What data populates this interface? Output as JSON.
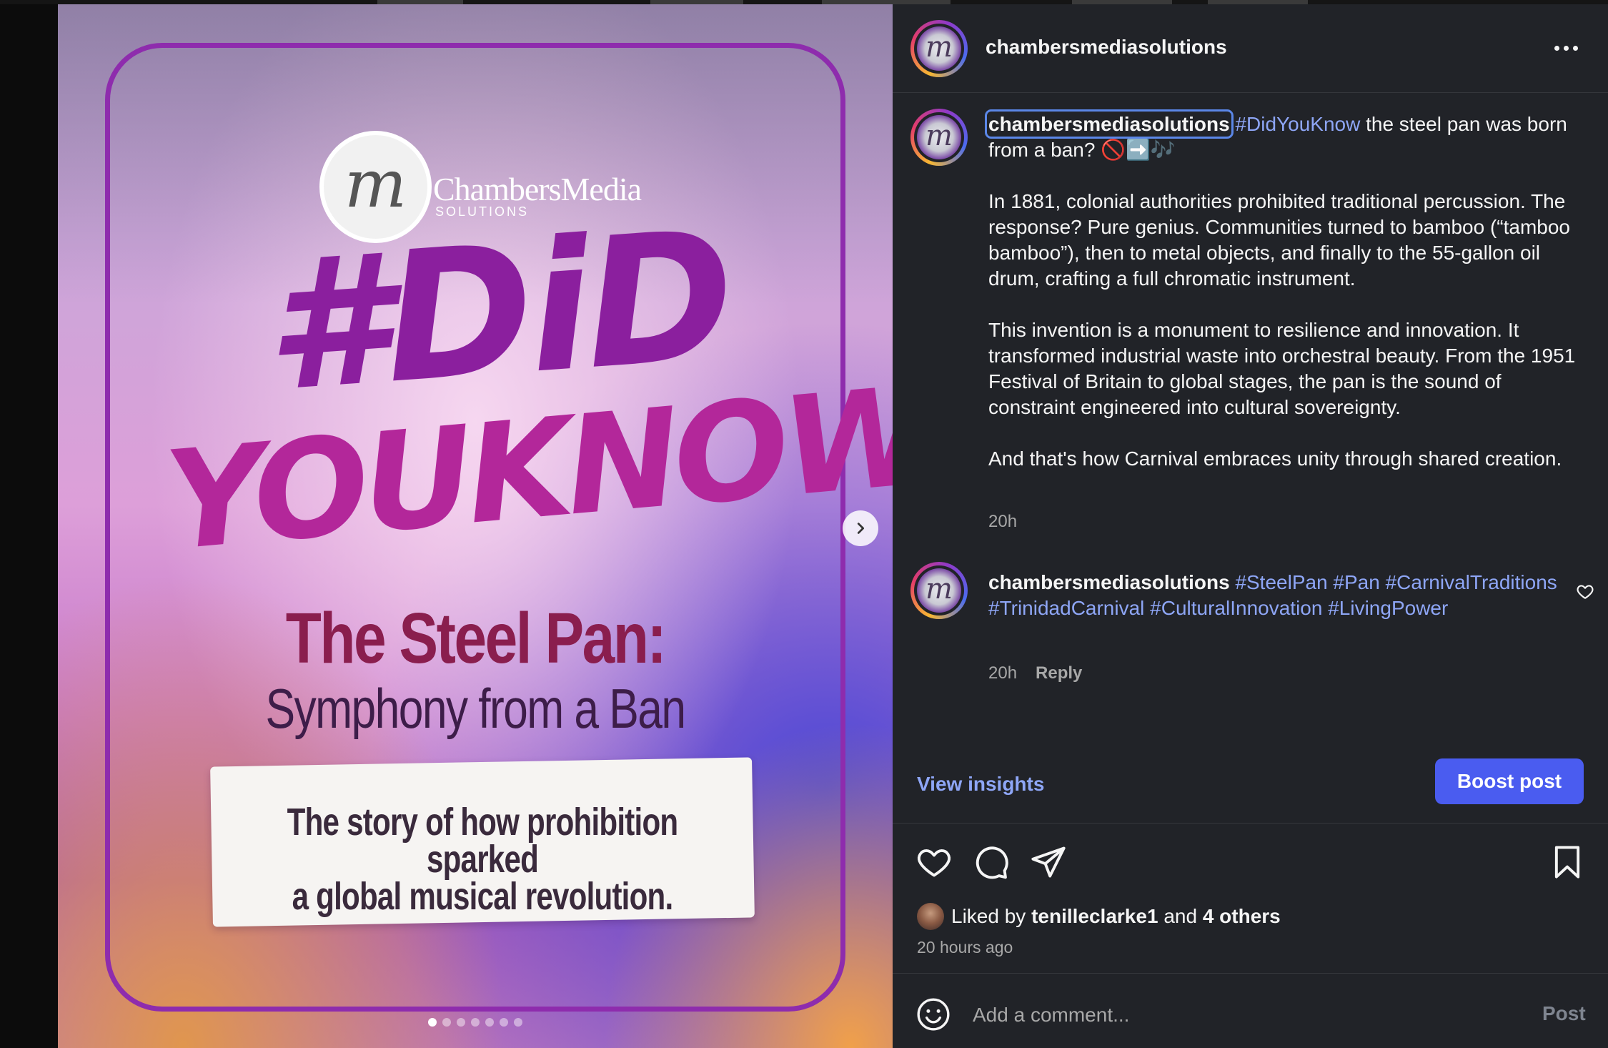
{
  "post_image": {
    "brand_initial": "m",
    "brand_name": "ChambersMedia",
    "brand_subtitle": "SOLUTIONS",
    "headline_line1": "#DiD",
    "headline_line2": "YOUKNOW",
    "title_line1": "The Steel Pan:",
    "title_line2": "Symphony from a Ban",
    "tagline_line1": "The story of how prohibition sparked",
    "tagline_line2": "a global musical revolution.",
    "carousel_total": 7,
    "carousel_active_index": 0
  },
  "header": {
    "username": "chambersmediasolutions",
    "avatar_initial": "m",
    "more_icon": "more-horizontal-icon"
  },
  "caption": {
    "username": "chambersmediasolutions",
    "hashtag": "#DidYouKnow",
    "line1_rest": " the steel pan was born from a ban? 🚫➡️🎶",
    "para2": "In 1881, colonial authorities prohibited traditional percussion. The response? Pure genius. Communities turned to bamboo (“tamboo bamboo”), then to metal objects, and finally to the 55-gallon oil drum, crafting a full chromatic instrument.",
    "para3": "This invention is a monument to resilience and innovation. It transformed industrial waste into orchestral beauty. From the 1951 Festival of Britain to global stages, the pan is the sound of constraint engineered into cultural sovereignty.",
    "para4": "And that's how Carnival embraces unity through shared creation.",
    "time": "20h"
  },
  "comment": {
    "username": "chambersmediasolutions",
    "hashtags": "#SteelPan #Pan #CarnivalTraditions #TrinidadCarnival #CulturalInnovation #LivingPower",
    "time": "20h",
    "reply_label": "Reply"
  },
  "actions": {
    "view_insights": "View insights",
    "boost_post": "Boost post"
  },
  "likes": {
    "liked_by_prefix": "Liked by",
    "liked_by_user": "tenilleclarke1",
    "and_text": "and",
    "others": "4 others",
    "time_ago": "20 hours ago"
  },
  "comment_box": {
    "placeholder": "Add a comment...",
    "post_label": "Post"
  },
  "colors": {
    "panel_bg": "#212328",
    "accent_blue": "#4a5cf0",
    "link_blue": "#8ea6f6",
    "frame_purple": "#8e2cad"
  }
}
